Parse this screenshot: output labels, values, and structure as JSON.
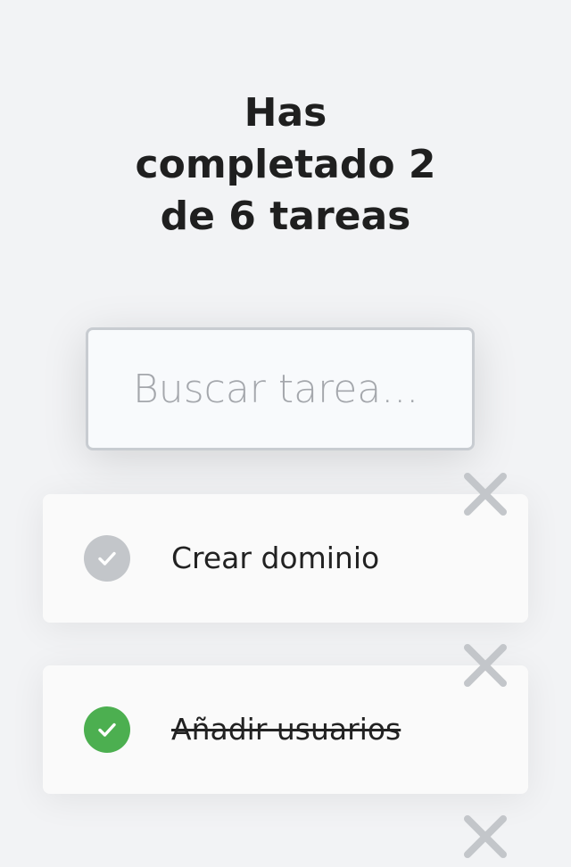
{
  "header": {
    "title_line1": "Has",
    "title_line2": "completado 2",
    "title_line3": "de 6 tareas"
  },
  "search": {
    "placeholder": "Buscar tarea..."
  },
  "todos": [
    {
      "text": "Crear dominio",
      "completed": false
    },
    {
      "text": "Añadir usuarios",
      "completed": true
    }
  ],
  "icons": {
    "check": "check-icon",
    "delete": "close-icon"
  },
  "colors": {
    "background": "#f2f3f5",
    "check_incomplete": "#c3c6ca",
    "check_complete": "#4caf50",
    "delete_icon": "#c3c6ca",
    "text": "#1f1f1f"
  }
}
